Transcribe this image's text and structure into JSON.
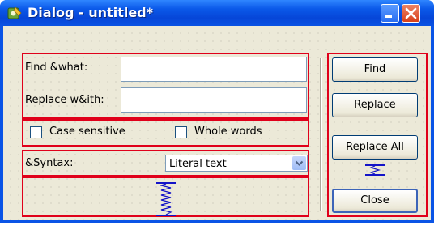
{
  "window": {
    "title": "Dialog - untitled*"
  },
  "form": {
    "find_label": "Find &what:",
    "find_value": "",
    "replace_label": "Replace w&ith:",
    "replace_value": "",
    "case_sensitive_label": "Case sensitive",
    "case_sensitive_checked": false,
    "whole_words_label": "Whole words",
    "whole_words_checked": false,
    "syntax_label": "&Syntax:",
    "syntax_value": "Literal text"
  },
  "buttons": {
    "find": "Find",
    "replace": "Replace",
    "replace_all": "Replace All",
    "close": "Close"
  },
  "colors": {
    "layout_highlight": "#e0001a",
    "titlebar": "#0a58e8",
    "client_background": "#ece9d8"
  },
  "icons": {
    "app": "designer-icon",
    "minimize": "minimize-icon",
    "close": "close-icon",
    "combo_arrow": "chevron-down-icon",
    "spacer": "spacer-icon"
  }
}
